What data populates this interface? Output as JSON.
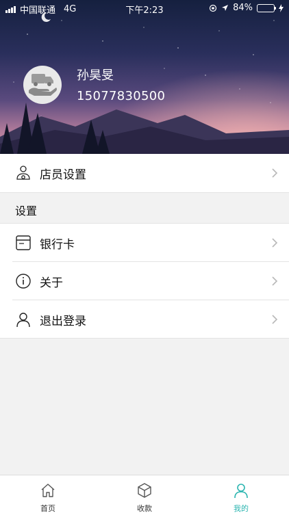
{
  "status_bar": {
    "carrier": "中国联通",
    "network": "4G",
    "time": "下午2:23",
    "battery": "84%",
    "battery_level": 0.84
  },
  "profile": {
    "name": "孙昊旻",
    "phone": "15077830500"
  },
  "menu": {
    "staff_settings": {
      "label": "店员设置",
      "icon": "staff-icon"
    },
    "section_title": "设置",
    "items": [
      {
        "label": "银行卡",
        "icon": "bank-card-icon"
      },
      {
        "label": "关于",
        "icon": "info-icon"
      },
      {
        "label": "退出登录",
        "icon": "person-icon"
      }
    ]
  },
  "tabbar": {
    "tabs": [
      {
        "label": "首页",
        "icon": "home-icon",
        "active": false
      },
      {
        "label": "收款",
        "icon": "box-icon",
        "active": false
      },
      {
        "label": "我的",
        "icon": "user-icon",
        "active": true
      }
    ],
    "active_color": "#2bb5b0"
  }
}
